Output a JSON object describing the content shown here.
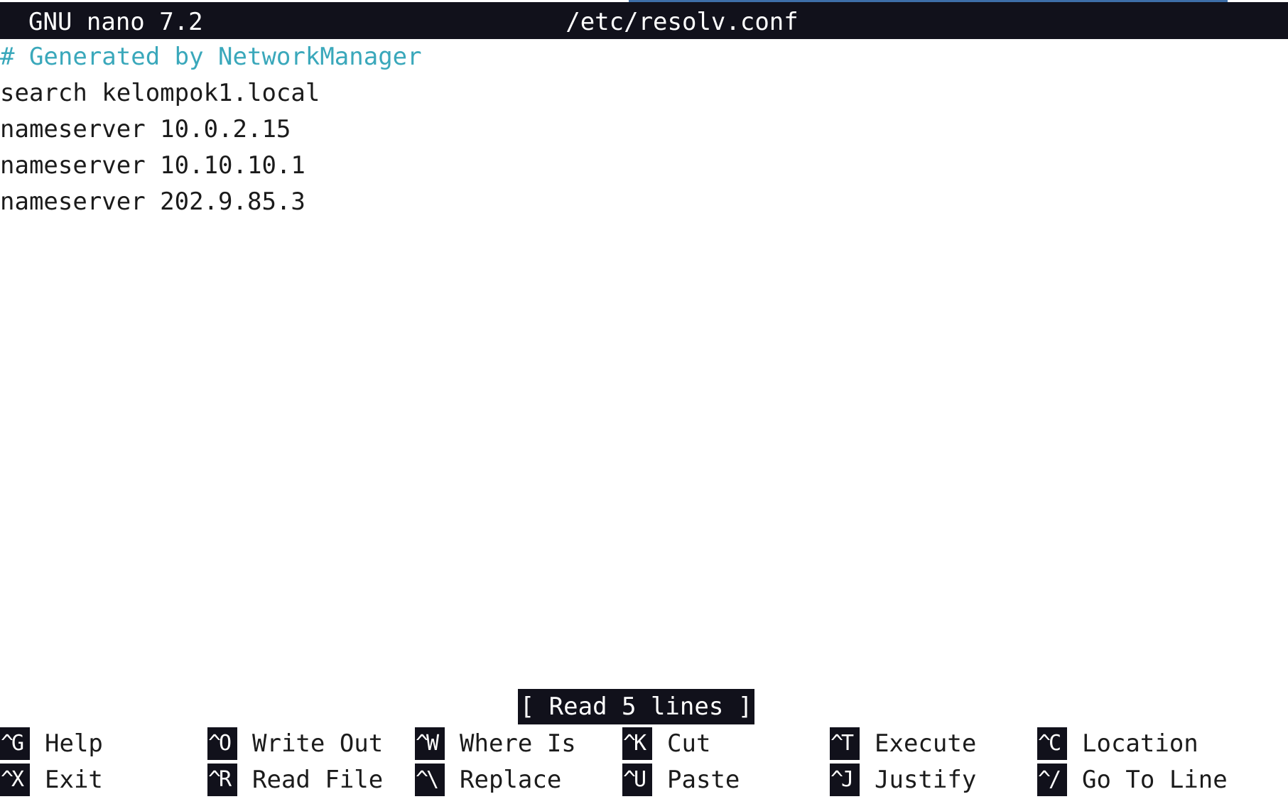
{
  "window": {
    "app_title": "GNU nano 7.2",
    "file_title": "/etc/resolv.conf"
  },
  "editor": {
    "lines": [
      "# Generated by NetworkManager",
      "search kelompok1.local",
      "nameserver 10.0.2.15",
      "nameserver 10.10.10.1",
      "nameserver 202.9.85.3"
    ]
  },
  "status": {
    "message": "[ Read 5 lines ]"
  },
  "shortcuts": {
    "row1": [
      {
        "key": "^G",
        "label": "Help"
      },
      {
        "key": "^O",
        "label": "Write Out"
      },
      {
        "key": "^W",
        "label": "Where Is"
      },
      {
        "key": "^K",
        "label": "Cut"
      },
      {
        "key": "^T",
        "label": "Execute"
      },
      {
        "key": "^C",
        "label": "Location"
      }
    ],
    "row2": [
      {
        "key": "^X",
        "label": "Exit"
      },
      {
        "key": "^R",
        "label": "Read File"
      },
      {
        "key": "^\\",
        "label": "Replace"
      },
      {
        "key": "^U",
        "label": "Paste"
      },
      {
        "key": "^J",
        "label": "Justify"
      },
      {
        "key": "^/",
        "label": "Go To Line"
      }
    ]
  },
  "colors": {
    "terminal_bg": "#ffffff",
    "bar_bg": "#11111b",
    "text": "#1b1b1b",
    "comment": "#3aa8bb"
  }
}
